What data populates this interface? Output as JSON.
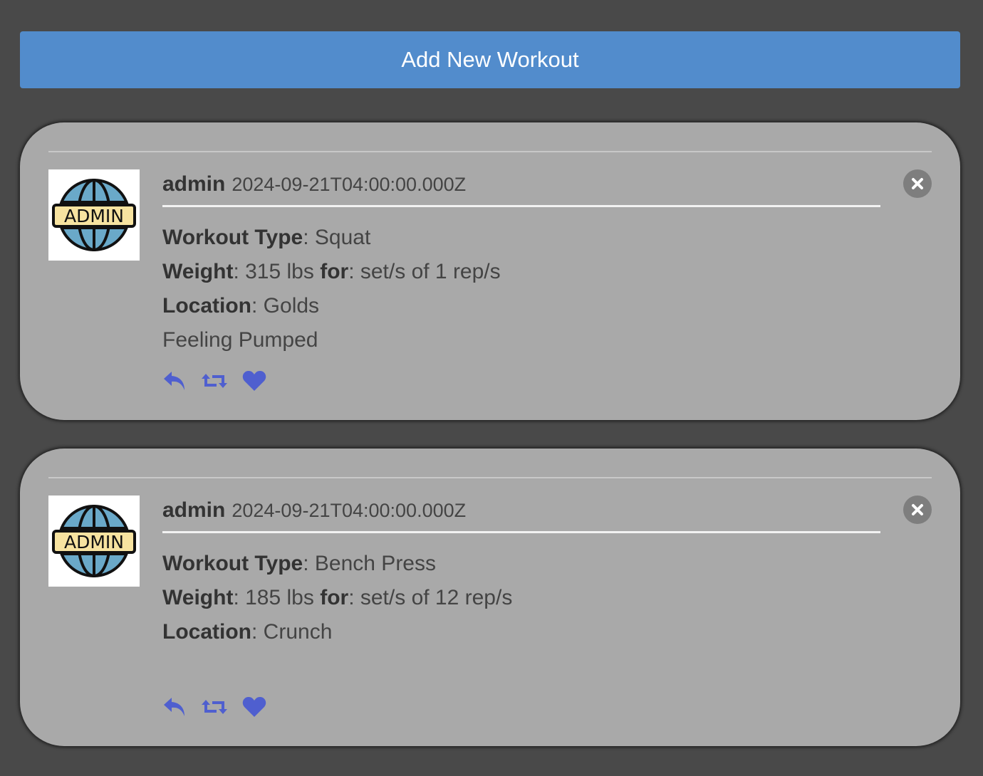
{
  "add_button_label": "Add New Workout",
  "colors": {
    "background": "#494949",
    "accent": "#528ccc",
    "card": "#a9a9a9",
    "action_icon": "#4f5fcf"
  },
  "workouts": [
    {
      "avatar_text": "ADMIN",
      "username": "admin",
      "timestamp": "2024-09-21T04:00:00.000Z",
      "workout_type_label": "Workout Type",
      "workout_type": "Squat",
      "weight_label": "Weight",
      "weight": "315 lbs",
      "for_label": "for",
      "sets_reps": "set/s of 1 rep/s",
      "location_label": "Location",
      "location": "Golds",
      "note": "Feeling Pumped",
      "icons": [
        "close-icon",
        "reply-icon",
        "retweet-icon",
        "heart-icon"
      ]
    },
    {
      "avatar_text": "ADMIN",
      "username": "admin",
      "timestamp": "2024-09-21T04:00:00.000Z",
      "workout_type_label": "Workout Type",
      "workout_type": "Bench Press",
      "weight_label": "Weight",
      "weight": "185 lbs",
      "for_label": "for",
      "sets_reps": "set/s of 12 rep/s",
      "location_label": "Location",
      "location": "Crunch",
      "note": "",
      "icons": [
        "close-icon",
        "reply-icon",
        "retweet-icon",
        "heart-icon"
      ]
    }
  ]
}
